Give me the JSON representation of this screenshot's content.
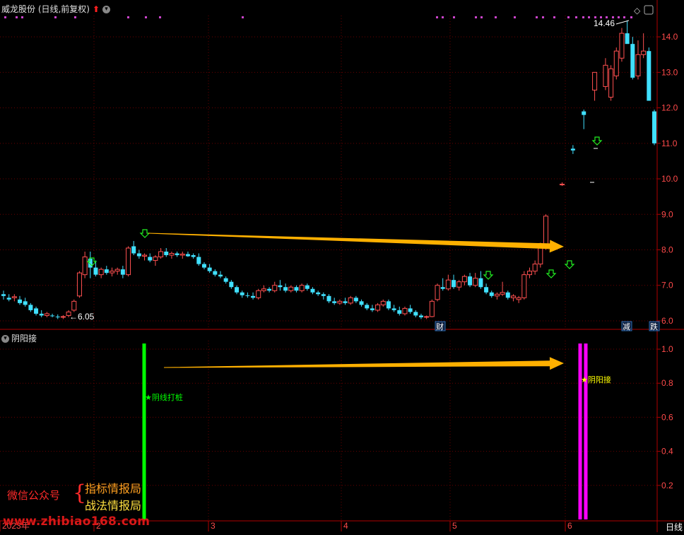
{
  "header": {
    "title": "威龙股份 (日线,前复权)",
    "indicator_title": "阴阳接",
    "period_label": "日线"
  },
  "watermark": {
    "line1": "微信公众号",
    "line2": "指标情报局",
    "line3": "战法情报局",
    "url": "www.zhibiao168.com"
  },
  "colors": {
    "up": "#ff5050",
    "down": "#40e0ff",
    "axis": "#b00000",
    "grid": "#6a0000",
    "arrow": "#ffb000",
    "signal_green": "#00ff00",
    "signal_magenta": "#ff00ff",
    "signal_star": "#ffff00",
    "markers": "#cc44cc"
  },
  "chart_data": [
    {
      "type": "candlestick",
      "title": "威龙股份 (日线,前复权)",
      "ylim": [
        5.8,
        14.6
      ],
      "yticks": [
        6.0,
        7.0,
        8.0,
        9.0,
        10.0,
        11.0,
        12.0,
        13.0,
        14.0
      ],
      "x_labels": [
        "2023年",
        "2",
        "3",
        "4",
        "5",
        "6"
      ],
      "grid": true,
      "annotations": {
        "high_label": "14.46",
        "low_label": "6.05",
        "badges": [
          "财",
          "减",
          "跌"
        ]
      },
      "candles": [
        [
          6.75,
          6.85,
          6.6,
          6.7
        ],
        [
          6.65,
          6.75,
          6.55,
          6.6
        ],
        [
          6.65,
          6.75,
          6.55,
          6.68
        ],
        [
          6.6,
          6.7,
          6.45,
          6.5
        ],
        [
          6.55,
          6.65,
          6.4,
          6.45
        ],
        [
          6.45,
          6.5,
          6.25,
          6.3
        ],
        [
          6.35,
          6.4,
          6.15,
          6.2
        ],
        [
          6.2,
          6.3,
          6.1,
          6.15
        ],
        [
          6.15,
          6.25,
          6.1,
          6.2
        ],
        [
          6.15,
          6.2,
          6.1,
          6.14
        ],
        [
          6.12,
          6.18,
          6.05,
          6.1
        ],
        [
          6.1,
          6.16,
          6.05,
          6.12
        ],
        [
          6.15,
          6.3,
          6.1,
          6.25
        ],
        [
          6.3,
          6.6,
          6.25,
          6.55
        ],
        [
          6.7,
          7.4,
          6.65,
          7.35
        ],
        [
          7.3,
          7.95,
          7.2,
          7.8
        ],
        [
          7.75,
          7.95,
          7.2,
          7.5
        ],
        [
          7.5,
          7.7,
          7.25,
          7.3
        ],
        [
          7.3,
          7.5,
          7.2,
          7.45
        ],
        [
          7.45,
          7.55,
          7.3,
          7.35
        ],
        [
          7.35,
          7.5,
          7.25,
          7.4
        ],
        [
          7.4,
          7.5,
          7.3,
          7.45
        ],
        [
          7.45,
          7.55,
          7.2,
          7.3
        ],
        [
          7.3,
          8.1,
          7.25,
          8.05
        ],
        [
          8.1,
          8.25,
          7.85,
          7.9
        ],
        [
          7.9,
          8.0,
          7.75,
          7.82
        ],
        [
          7.82,
          7.9,
          7.7,
          7.85
        ],
        [
          7.8,
          7.9,
          7.65,
          7.7
        ],
        [
          7.7,
          7.85,
          7.55,
          7.8
        ],
        [
          7.8,
          8.05,
          7.75,
          7.95
        ],
        [
          7.95,
          8.05,
          7.8,
          7.85
        ],
        [
          7.85,
          7.95,
          7.75,
          7.9
        ],
        [
          7.9,
          7.95,
          7.8,
          7.85
        ],
        [
          7.85,
          7.95,
          7.75,
          7.88
        ],
        [
          7.88,
          7.95,
          7.8,
          7.82
        ],
        [
          7.85,
          7.9,
          7.75,
          7.8
        ],
        [
          7.8,
          7.9,
          7.55,
          7.6
        ],
        [
          7.6,
          7.65,
          7.45,
          7.5
        ],
        [
          7.5,
          7.6,
          7.35,
          7.4
        ],
        [
          7.4,
          7.45,
          7.25,
          7.3
        ],
        [
          7.3,
          7.4,
          7.2,
          7.25
        ],
        [
          7.2,
          7.25,
          7.05,
          7.1
        ],
        [
          7.1,
          7.15,
          6.9,
          6.95
        ],
        [
          6.95,
          7.0,
          6.75,
          6.8
        ],
        [
          6.8,
          6.85,
          6.65,
          6.72
        ],
        [
          6.72,
          6.8,
          6.65,
          6.7
        ],
        [
          6.7,
          6.8,
          6.6,
          6.65
        ],
        [
          6.65,
          6.9,
          6.6,
          6.85
        ],
        [
          6.85,
          7.0,
          6.8,
          6.9
        ],
        [
          6.9,
          6.95,
          6.8,
          6.85
        ],
        [
          6.85,
          7.1,
          6.8,
          7.0
        ],
        [
          7.0,
          7.15,
          6.85,
          6.95
        ],
        [
          6.95,
          7.05,
          6.8,
          6.85
        ],
        [
          6.85,
          7.0,
          6.8,
          6.95
        ],
        [
          6.95,
          7.0,
          6.8,
          6.85
        ],
        [
          6.85,
          7.05,
          6.8,
          7.0
        ],
        [
          7.0,
          7.05,
          6.85,
          6.9
        ],
        [
          6.9,
          6.95,
          6.75,
          6.8
        ],
        [
          6.8,
          6.85,
          6.7,
          6.75
        ],
        [
          6.75,
          6.8,
          6.6,
          6.7
        ],
        [
          6.7,
          6.75,
          6.5,
          6.55
        ],
        [
          6.55,
          6.65,
          6.45,
          6.5
        ],
        [
          6.5,
          6.6,
          6.45,
          6.55
        ],
        [
          6.55,
          6.65,
          6.45,
          6.5
        ],
        [
          6.5,
          6.7,
          6.45,
          6.65
        ],
        [
          6.65,
          6.7,
          6.5,
          6.55
        ],
        [
          6.55,
          6.6,
          6.4,
          6.45
        ],
        [
          6.45,
          6.5,
          6.3,
          6.35
        ],
        [
          6.35,
          6.45,
          6.25,
          6.3
        ],
        [
          6.3,
          6.5,
          6.25,
          6.45
        ],
        [
          6.45,
          6.6,
          6.4,
          6.55
        ],
        [
          6.55,
          6.6,
          6.3,
          6.35
        ],
        [
          6.35,
          6.45,
          6.25,
          6.3
        ],
        [
          6.3,
          6.4,
          6.15,
          6.2
        ],
        [
          6.2,
          6.4,
          6.15,
          6.35
        ],
        [
          6.35,
          6.45,
          6.2,
          6.25
        ],
        [
          6.25,
          6.3,
          6.1,
          6.15
        ],
        [
          6.15,
          6.2,
          6.05,
          6.1
        ],
        [
          6.1,
          6.15,
          6.05,
          6.12
        ],
        [
          6.12,
          6.6,
          6.1,
          6.55
        ],
        [
          6.6,
          7.05,
          6.55,
          7.0
        ],
        [
          6.95,
          7.2,
          6.85,
          6.9
        ],
        [
          6.9,
          7.3,
          6.85,
          7.15
        ],
        [
          7.15,
          7.3,
          6.9,
          6.95
        ],
        [
          6.95,
          7.15,
          6.85,
          7.1
        ],
        [
          7.1,
          7.3,
          7.0,
          7.25
        ],
        [
          7.25,
          7.35,
          6.95,
          7.0
        ],
        [
          7.0,
          7.35,
          6.95,
          7.2
        ],
        [
          7.2,
          7.4,
          6.9,
          6.95
        ],
        [
          6.95,
          7.05,
          6.75,
          6.8
        ],
        [
          6.8,
          6.85,
          6.65,
          6.7
        ],
        [
          6.7,
          6.8,
          6.6,
          6.75
        ],
        [
          6.75,
          7.1,
          6.7,
          6.8
        ],
        [
          6.8,
          6.85,
          6.6,
          6.65
        ],
        [
          6.65,
          6.75,
          6.55,
          6.7
        ],
        [
          6.6,
          6.7,
          6.5,
          6.65
        ],
        [
          6.65,
          7.4,
          6.6,
          7.3
        ],
        [
          7.3,
          7.5,
          7.2,
          7.4
        ],
        [
          7.4,
          7.7,
          7.3,
          7.6
        ],
        [
          7.6,
          8.2,
          7.5,
          8.1
        ],
        [
          8.1,
          9.0,
          8.0,
          8.95
        ],
        null,
        null,
        [
          9.85,
          9.9,
          9.8,
          9.85
        ],
        null,
        [
          10.85,
          10.95,
          10.7,
          10.8
        ],
        null,
        [
          11.9,
          11.95,
          11.4,
          11.8
        ],
        null,
        [
          12.5,
          13.0,
          12.2,
          13.0
        ],
        null,
        [
          12.6,
          13.4,
          12.5,
          13.2
        ],
        [
          12.3,
          13.2,
          12.2,
          13.1
        ],
        [
          12.9,
          13.7,
          12.8,
          13.6
        ],
        [
          13.4,
          14.25,
          13.3,
          14.1
        ],
        [
          14.1,
          14.46,
          13.9,
          13.8
        ],
        [
          13.8,
          14.0,
          12.8,
          12.85
        ],
        [
          12.9,
          13.9,
          12.8,
          13.5
        ],
        [
          13.5,
          14.1,
          13.4,
          13.6
        ],
        [
          13.6,
          13.7,
          12.2,
          12.2
        ],
        [
          11.9,
          11.95,
          10.95,
          11.0
        ]
      ]
    },
    {
      "type": "bar",
      "title": "阴阳接",
      "ylim": [
        0,
        1.05
      ],
      "yticks": [
        0.2,
        0.4,
        0.6,
        0.8,
        1.0
      ],
      "signals": [
        {
          "label": "★阴线打桩",
          "value": 1.0,
          "color": "#00ff00"
        },
        {
          "label": "★阴阳接",
          "value": 1.0,
          "color": "#ff00ff"
        }
      ]
    }
  ]
}
